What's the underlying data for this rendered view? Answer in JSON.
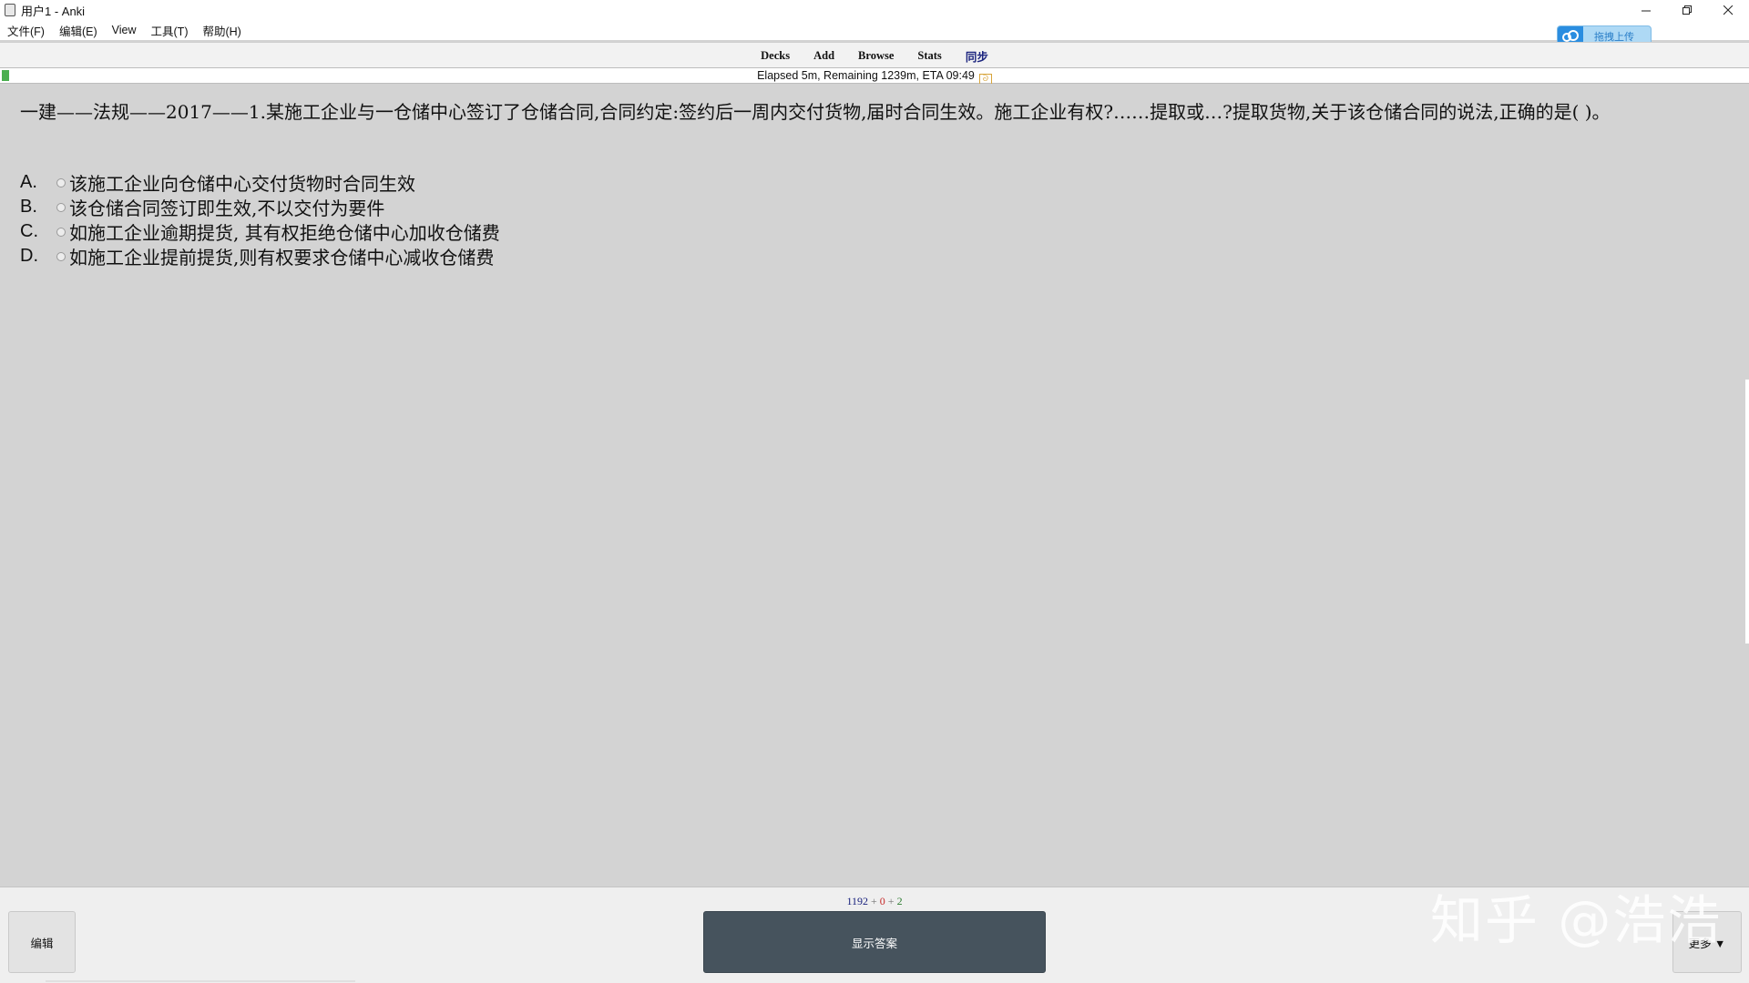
{
  "window": {
    "title": "用户1 - Anki",
    "minimize_icon": "minimize-icon",
    "maximize_icon": "restore-icon",
    "close_icon": "close-icon"
  },
  "menu": {
    "items": [
      "文件(F)",
      "编辑(E)",
      "View",
      "工具(T)",
      "帮助(H)"
    ]
  },
  "upload_widget": {
    "label": "拖拽上传",
    "icon": "cloud-icon",
    "colors": {
      "accent": "#2a8de0",
      "background": "#aed9f5"
    }
  },
  "toplinks": {
    "items": [
      "Decks",
      "Add",
      "Browse",
      "Stats",
      "同步"
    ]
  },
  "progress": {
    "text": "Elapsed 5m, Remaining 1239m, ETA 09:49",
    "fraction": 0.004,
    "color": "#4caf50"
  },
  "card": {
    "question": "一建——法规——2017——1.某施工企业与一仓储中心签订了仓储合同,合同约定:签约后一周内交付货物,届时合同生效。施工企业有权?……提取或…?提取货物,关于该仓储合同的说法,正确的是( )。",
    "options": [
      {
        "letter": "A.",
        "text": "该施工企业向仓储中心交付货物时合同生效"
      },
      {
        "letter": "B.",
        "text": "该仓储合同签订即生效,不以交付为要件"
      },
      {
        "letter": "C.",
        "text": "如施工企业逾期提货, 其有权拒绝仓储中心加收仓储费"
      },
      {
        "letter": "D.",
        "text": "如施工企业提前提货,则有权要求仓储中心减收仓储费"
      }
    ]
  },
  "bottom": {
    "counts": {
      "new": "1192",
      "sep": "+",
      "learn": "0",
      "review": "2"
    },
    "edit_label": "编辑",
    "answer_label": "显示答案",
    "more_label": "更多 ▼",
    "colors": {
      "answer_button": "#46535d",
      "new": "#1a237e",
      "learn": "#c62828",
      "review": "#2e7d32"
    }
  },
  "watermark": "知乎 @浩浩"
}
